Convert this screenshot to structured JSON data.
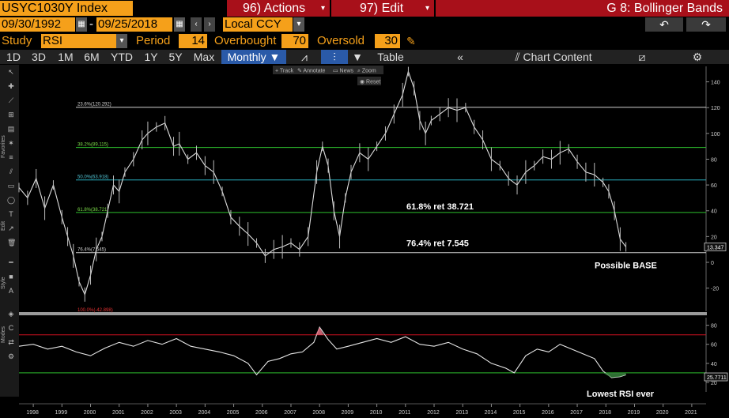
{
  "header": {
    "ticker": "USYC1030Y Index",
    "actions_label": "96) Actions",
    "edit_label": "97) Edit",
    "page_title": "G 8: Bollinger Bands"
  },
  "dates": {
    "start": "09/30/1992",
    "separator": "-",
    "end": "09/25/2018",
    "currency": "Local CCY"
  },
  "study": {
    "label": "Study",
    "value": "RSI",
    "period_label": "Period",
    "period": "14",
    "overbought_label": "Overbought",
    "overbought": "70",
    "oversold_label": "Oversold",
    "oversold": "30"
  },
  "toolbar": {
    "ranges": [
      "1D",
      "3D",
      "1M",
      "6M",
      "YTD",
      "1Y",
      "5Y",
      "Max"
    ],
    "frequency": "Monthly",
    "table_label": "Table",
    "chart_content_label": "Chart Content"
  },
  "chart_tools": {
    "track": "Track",
    "annotate": "Annotate",
    "news": "News",
    "zoom": "Zoom",
    "reset": "Reset"
  },
  "side_labels": {
    "favorites": "Favorites",
    "edit": "Edit",
    "style": "Style",
    "modes": "Modes"
  },
  "colors": {
    "accent_orange": "#f5a01a",
    "header_red": "#a8101a",
    "fib_green": "#2ec02e",
    "fib_cyan": "#2ab0c0",
    "rsi_red": "#d01020",
    "price_line": "#dddddd"
  },
  "chart_data": [
    {
      "type": "line",
      "yticks": [
        -20,
        0,
        20,
        40,
        60,
        80,
        100,
        120,
        140
      ],
      "ylim": [
        -38,
        152
      ],
      "x_labels": [
        "1998",
        "1999",
        "2000",
        "2001",
        "2002",
        "2003",
        "2004",
        "2005",
        "2006",
        "2007",
        "2008",
        "2009",
        "2010",
        "2011",
        "2012",
        "2013",
        "2014",
        "2015",
        "2016",
        "2017",
        "2018",
        "2019",
        "2020",
        "2021"
      ],
      "last_value": "13.347",
      "series": [
        {
          "x": [
            1997.5,
            1997.8,
            1998.1,
            1998.4,
            1998.7,
            1999.0,
            1999.2,
            1999.4,
            1999.6,
            1999.8,
            2000.0,
            2000.2,
            2000.4,
            2000.6,
            2000.8,
            2001.0,
            2001.2,
            2001.5,
            2001.8,
            2002.0,
            2002.3,
            2002.6,
            2002.9,
            2003.1,
            2003.4,
            2003.7,
            2004.0,
            2004.3,
            2004.6,
            2004.9,
            2005.2,
            2005.5,
            2005.8,
            2006.1,
            2006.4,
            2006.7,
            2007.0,
            2007.3,
            2007.6,
            2007.9,
            2008.1,
            2008.3,
            2008.5,
            2008.7,
            2008.9,
            2009.1,
            2009.4,
            2009.7,
            2010.0,
            2010.3,
            2010.6,
            2010.9,
            2011.1,
            2011.3,
            2011.5,
            2011.7,
            2011.9,
            2012.2,
            2012.5,
            2012.8,
            2013.1,
            2013.4,
            2013.7,
            2014.0,
            2014.3,
            2014.6,
            2014.9,
            2015.2,
            2015.5,
            2015.8,
            2016.1,
            2016.4,
            2016.7,
            2017.0,
            2017.3,
            2017.6,
            2017.9,
            2018.1,
            2018.3,
            2018.5,
            2018.7
          ],
          "values": [
            58,
            50,
            65,
            42,
            60,
            35,
            20,
            5,
            -15,
            -25,
            -10,
            10,
            20,
            40,
            60,
            55,
            70,
            80,
            95,
            100,
            105,
            108,
            90,
            92,
            80,
            85,
            75,
            70,
            55,
            35,
            28,
            22,
            15,
            5,
            10,
            12,
            15,
            10,
            20,
            70,
            90,
            75,
            40,
            20,
            50,
            70,
            85,
            80,
            90,
            100,
            115,
            130,
            148,
            135,
            110,
            100,
            110,
            115,
            120,
            118,
            120,
            105,
            95,
            80,
            75,
            65,
            60,
            70,
            75,
            82,
            80,
            85,
            88,
            78,
            70,
            68,
            62,
            55,
            40,
            18,
            12
          ]
        }
      ],
      "levels": [
        {
          "label": "23.6%(120.292)",
          "value": 120.292
        },
        {
          "label": "38.2%(89.115)",
          "value": 89.115
        },
        {
          "label": "50.0%(63.918)",
          "value": 63.918
        },
        {
          "label": "61.8%(38.721)",
          "value": 38.721
        },
        {
          "label": "76.4%(7.545)",
          "value": 7.545
        },
        {
          "label": "100.0%(-42.898)",
          "value": -42.898
        }
      ],
      "annotations": [
        "61.8% ret 38.721",
        "76.4% ret 7.545",
        "Possible BASE"
      ]
    },
    {
      "type": "line",
      "yticks": [
        20,
        40,
        60,
        80
      ],
      "ylim": [
        10,
        88
      ],
      "overbought": 70,
      "oversold": 30,
      "last_value": "25.7711",
      "series": [
        {
          "x": [
            1997.5,
            1998.0,
            1998.5,
            1999.0,
            1999.5,
            2000.0,
            2000.5,
            2001.0,
            2001.5,
            2002.0,
            2002.5,
            2003.0,
            2003.5,
            2004.0,
            2004.5,
            2005.0,
            2005.5,
            2005.8,
            2006.2,
            2006.6,
            2007.0,
            2007.4,
            2007.8,
            2008.0,
            2008.3,
            2008.6,
            2009.0,
            2009.5,
            2010.0,
            2010.5,
            2011.0,
            2011.5,
            2012.0,
            2012.5,
            2013.0,
            2013.5,
            2014.0,
            2014.5,
            2014.8,
            2015.2,
            2015.6,
            2016.0,
            2016.4,
            2016.8,
            2017.2,
            2017.6,
            2017.9,
            2018.2,
            2018.5,
            2018.7
          ],
          "values": [
            58,
            60,
            55,
            58,
            52,
            48,
            56,
            62,
            58,
            64,
            60,
            66,
            58,
            55,
            52,
            48,
            40,
            28,
            42,
            45,
            50,
            52,
            62,
            78,
            65,
            55,
            58,
            62,
            66,
            62,
            68,
            60,
            58,
            62,
            55,
            50,
            40,
            35,
            30,
            48,
            55,
            52,
            60,
            55,
            50,
            45,
            32,
            25,
            26,
            28
          ]
        }
      ],
      "annotations": [
        "Lowest RSI ever"
      ]
    }
  ]
}
